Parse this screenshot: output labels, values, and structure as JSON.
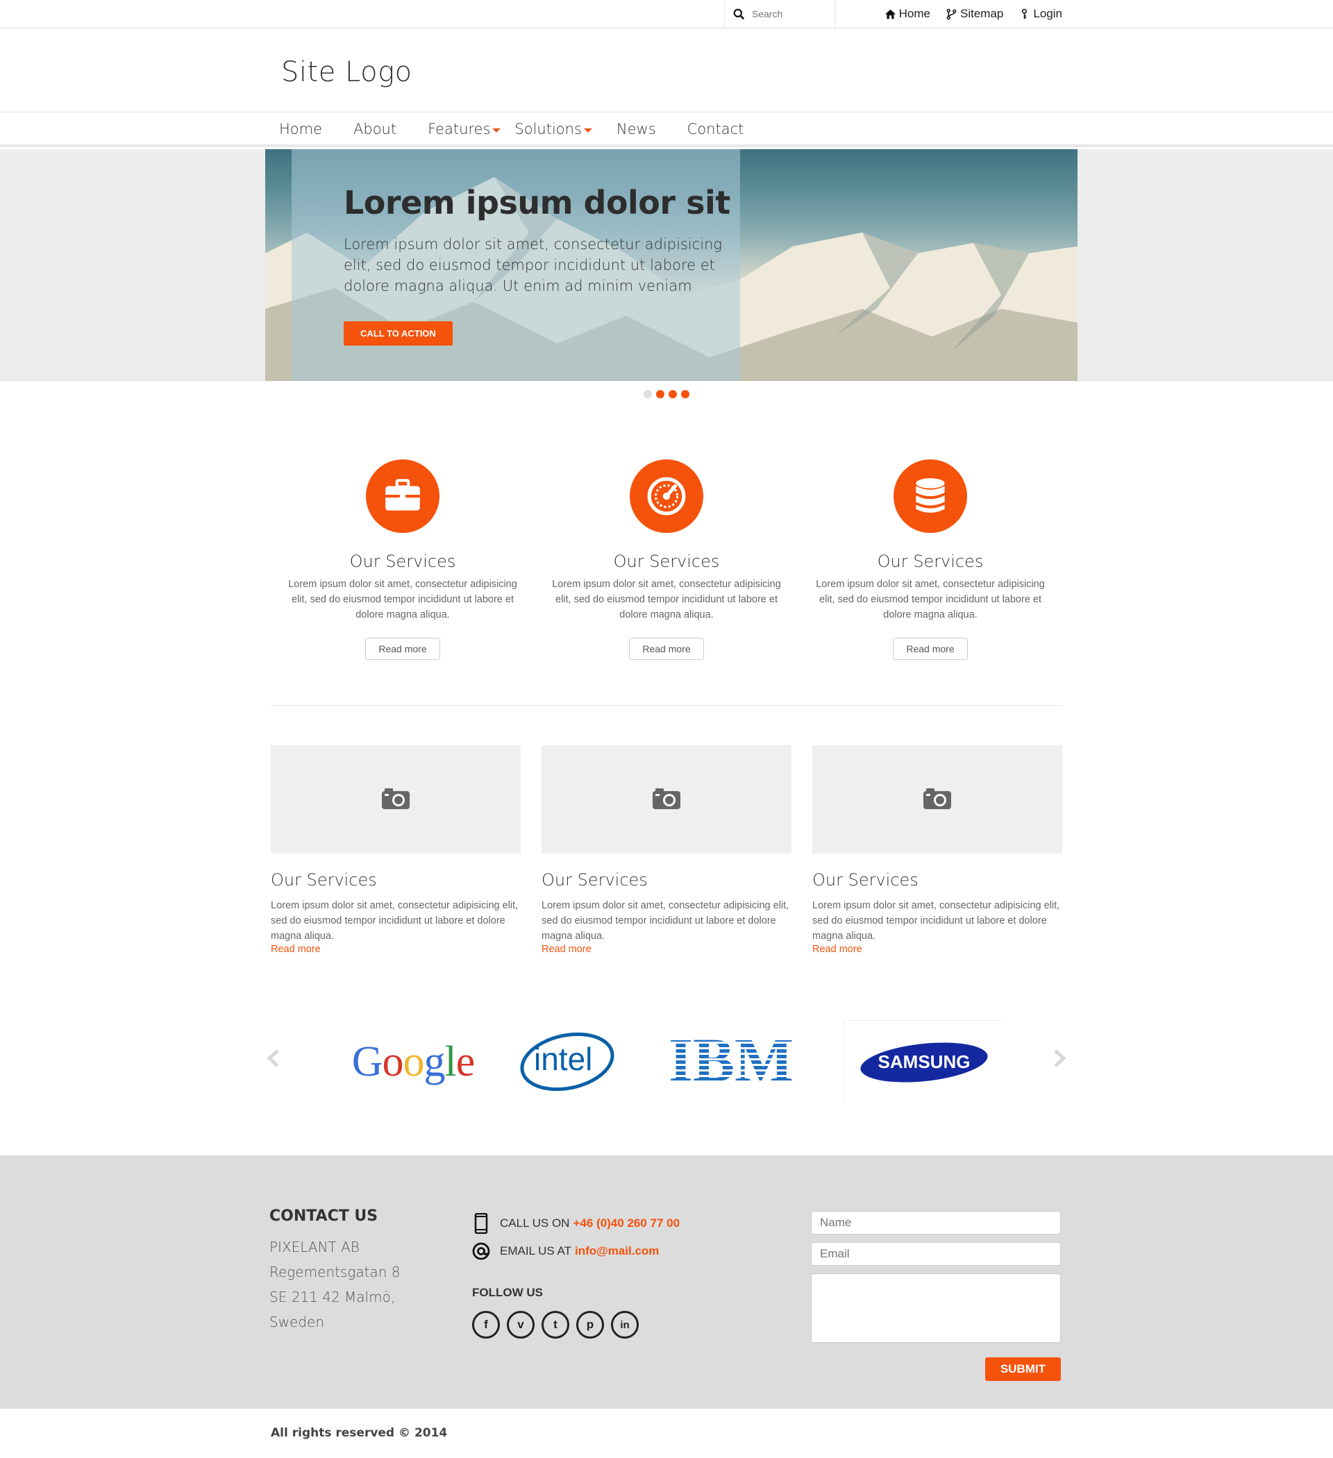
{
  "topbar": {
    "search_placeholder": "Search",
    "links": [
      {
        "label": "Home",
        "icon": "home-icon"
      },
      {
        "label": "Sitemap",
        "icon": "sitemap-icon"
      },
      {
        "label": "Login",
        "icon": "key-icon"
      }
    ]
  },
  "header": {
    "logo": "Site Logo"
  },
  "nav": {
    "items": [
      {
        "label": "Home",
        "dropdown": false
      },
      {
        "label": "About",
        "dropdown": false
      },
      {
        "label": "Features",
        "dropdown": true
      },
      {
        "label": "Solutions",
        "dropdown": true
      },
      {
        "label": "News",
        "dropdown": false
      },
      {
        "label": "Contact",
        "dropdown": false
      }
    ]
  },
  "hero": {
    "title": "Lorem ipsum dolor sit",
    "text": "Lorem ipsum dolor sit amet, consectetur adipisicing elit, sed do eiusmod tempor incididunt ut labore et dolore magna aliqua. Ut enim ad minim veniam",
    "cta": "CALL TO ACTION",
    "slides": 4,
    "active_slide": 1
  },
  "services": [
    {
      "icon": "briefcase-icon",
      "title": "Our Services",
      "text": "Lorem ipsum dolor sit amet, consectetur adipisicing elit, sed do eiusmod tempor incididunt ut labore et dolore magna aliqua.",
      "button": "Read more"
    },
    {
      "icon": "dashboard-icon",
      "title": "Our Services",
      "text": "Lorem ipsum dolor sit amet, consectetur adipisicing elit, sed do eiusmod tempor incididunt ut labore et dolore magna aliqua.",
      "button": "Read more"
    },
    {
      "icon": "database-icon",
      "title": "Our Services",
      "text": "Lorem ipsum dolor sit amet, consectetur adipisicing elit, sed do eiusmod tempor incididunt ut labore et dolore magna aliqua.",
      "button": "Read more"
    }
  ],
  "cards": [
    {
      "icon": "camera-icon",
      "title": "Our Services",
      "text": "Lorem ipsum dolor sit amet, consectetur adipisicing elit, sed do eiusmod tempor incididunt ut labore et dolore magna aliqua.",
      "link": "Read more"
    },
    {
      "icon": "camera-icon",
      "title": "Our Services",
      "text": "Lorem ipsum dolor sit amet, consectetur adipisicing elit, sed do eiusmod tempor incididunt ut labore et dolore magna aliqua.",
      "link": "Read more"
    },
    {
      "icon": "camera-icon",
      "title": "Our Services",
      "text": "Lorem ipsum dolor sit amet, consectetur adipisicing elit, sed do eiusmod tempor incididunt ut labore et dolore magna aliqua.",
      "link": "Read more"
    }
  ],
  "partners": {
    "google": "Google",
    "intel": "intel",
    "ibm": "IBM",
    "samsung": "SAMSUNG"
  },
  "footer": {
    "contact_title": "CONTACT US",
    "address": [
      "PIXELANT AB",
      "Regementsgatan 8",
      "SE 211 42 Malmö,",
      "Sweden"
    ],
    "call_label": "CALL US ON",
    "phone": "+46 (0)40 260 77 00",
    "email_label": "EMAIL US AT",
    "email": "info@mail.com",
    "follow": "FOLLOW US",
    "social": [
      {
        "icon": "facebook-icon",
        "glyph": "f"
      },
      {
        "icon": "vimeo-icon",
        "glyph": "v"
      },
      {
        "icon": "twitter-icon",
        "glyph": "t"
      },
      {
        "icon": "pinterest-icon",
        "glyph": "p"
      },
      {
        "icon": "linkedin-icon",
        "glyph": "in"
      }
    ],
    "form": {
      "name_placeholder": "Name",
      "email_placeholder": "Email",
      "submit": "SUBMIT"
    },
    "copyright": "All rights reserved © 2014"
  },
  "colors": {
    "accent": "#f5520c",
    "footer_bg": "#dcdcdc"
  }
}
